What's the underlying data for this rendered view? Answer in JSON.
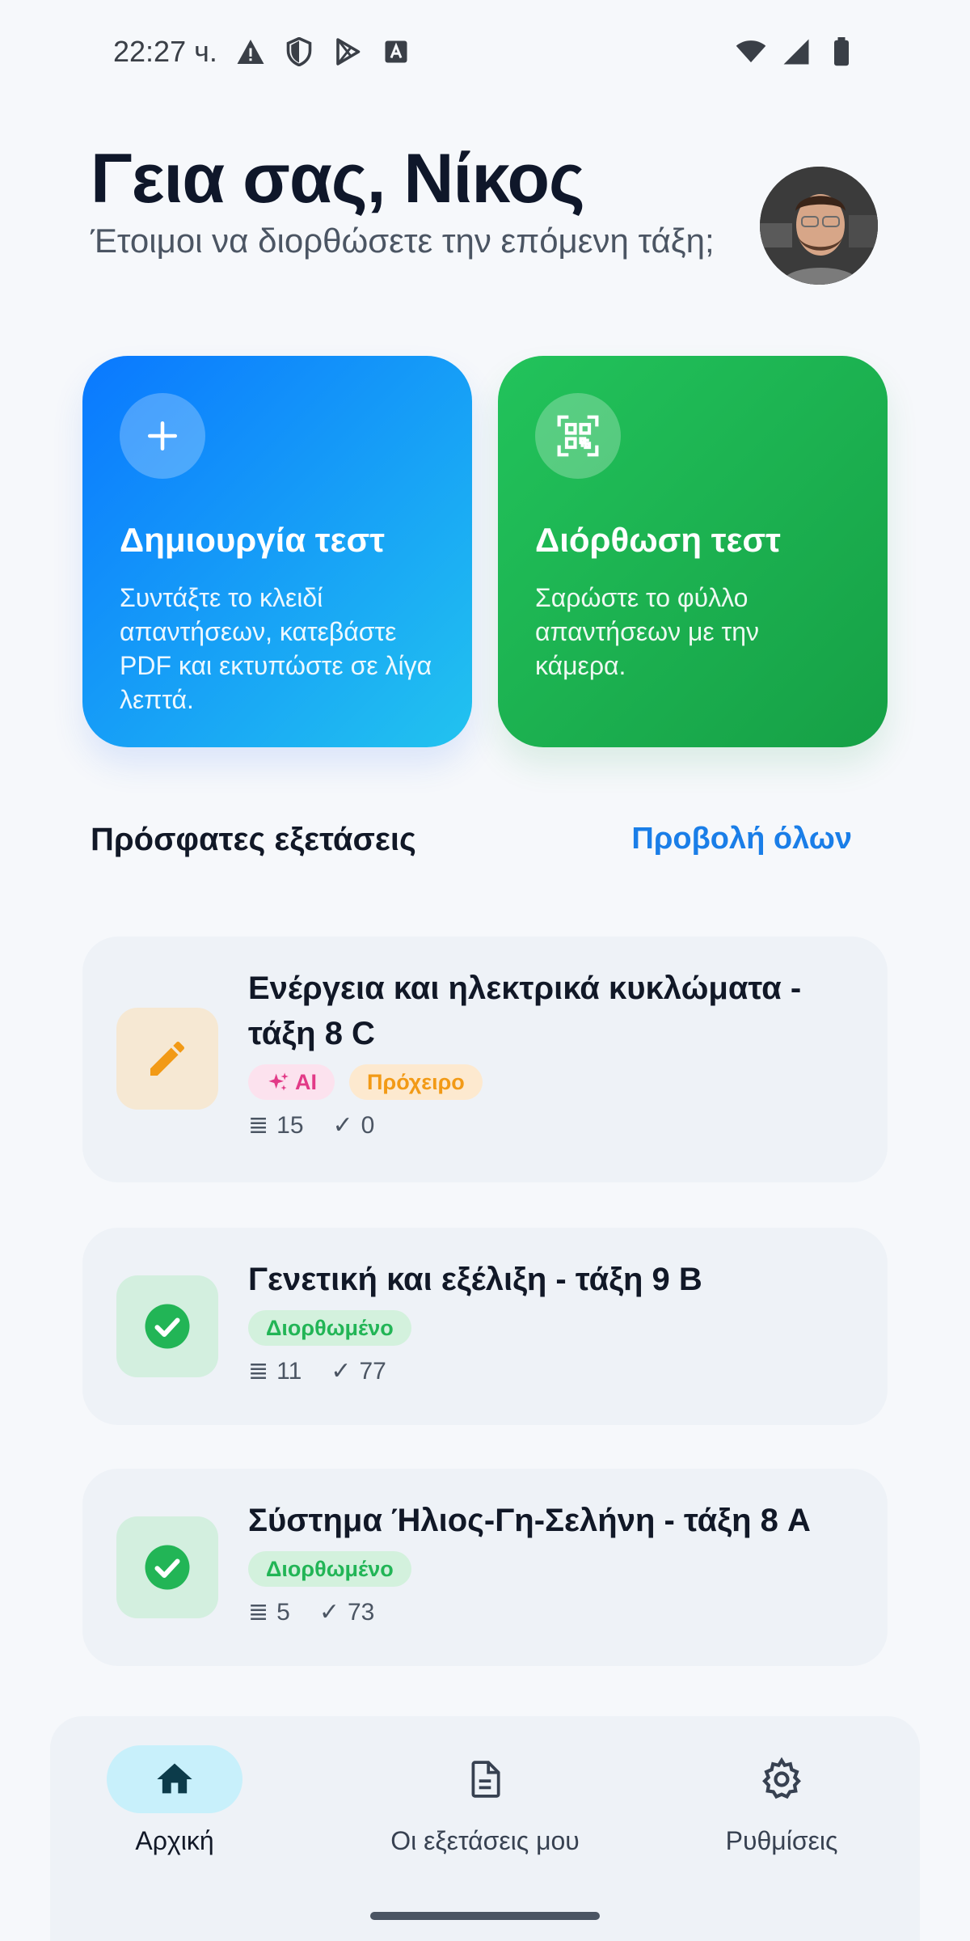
{
  "status_bar": {
    "time": "22:27 ч."
  },
  "header": {
    "greeting": "Γεια σας, Νίκος",
    "subtitle": "Έτοιμοι να διορθώσετε την επόμενη τάξη;"
  },
  "actions": {
    "create": {
      "title": "Δημιουργία τεστ",
      "description": "Συντάξτε το κλειδί απαντήσεων, κατεβάστε PDF και εκτυπώστε σε λίγα λεπτά."
    },
    "grade": {
      "title": "Διόρθωση τεστ",
      "description": "Σαρώστε το φύλλο απαντήσεων με την κάμερα."
    }
  },
  "recent": {
    "title": "Πρόσφατες εξετάσεις",
    "view_all": "Προβολή όλων",
    "exams": [
      {
        "title": "Ενέργεια και ηλεκτρικά κυκλώματα - τάξη 8 C",
        "icon": "pencil-icon",
        "badges": [
          "AI",
          "Πρόχειρο"
        ],
        "questions": "15",
        "graded": "0"
      },
      {
        "title": "Γενετική και εξέλιξη - τάξη 9 B",
        "icon": "check-circle-icon",
        "badges": [
          "Διορθωμένο"
        ],
        "questions": "11",
        "graded": "77"
      },
      {
        "title": "Σύστημα Ήλιος-Γη-Σελήνη - τάξη 8 A",
        "icon": "check-circle-icon",
        "badges": [
          "Διορθωμένο"
        ],
        "questions": "5",
        "graded": "73"
      }
    ]
  },
  "nav": {
    "home": "Αρχική",
    "exams": "Οι εξετάσεις μου",
    "settings": "Ρυθμίσεις"
  },
  "colors": {
    "primary_blue": "#0a78ff",
    "primary_green": "#22c35b",
    "draft_orange": "#f29a16",
    "ai_pink": "#e23a87",
    "graded_green": "#22b556"
  }
}
